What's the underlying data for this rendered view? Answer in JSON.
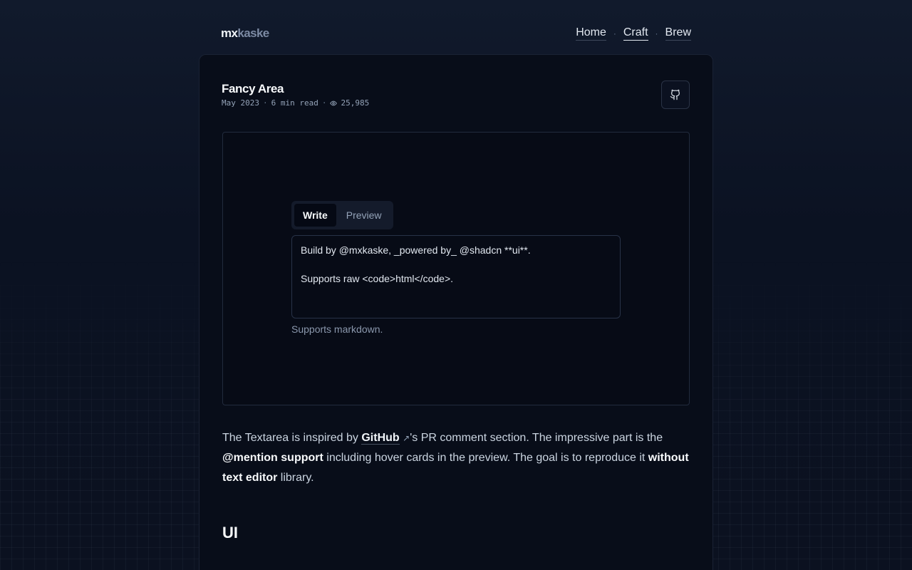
{
  "header": {
    "logo_part1": "mx",
    "logo_part2": "kaske",
    "nav": [
      {
        "label": "Home"
      },
      {
        "label": "Craft"
      },
      {
        "label": "Brew"
      }
    ],
    "nav_separator": "·"
  },
  "article": {
    "title": "Fancy Area",
    "date": "May 2023",
    "read_time": "6 min read",
    "views": "25,985",
    "meta_separator": "·",
    "github_icon": "github-icon"
  },
  "demo": {
    "tabs": [
      {
        "label": "Write",
        "active": true
      },
      {
        "label": "Preview",
        "active": false
      }
    ],
    "textarea_line1": "Build by @mxkaske, _powered by_ @shadcn **ui**.",
    "textarea_line2": "Supports raw <code>html</code>.",
    "hint": "Supports markdown."
  },
  "prose": {
    "p1_a": "The Textarea is inspired by ",
    "p1_link": "GitHub",
    "p1_b": "'s PR comment section. The impressive part is the ",
    "p1_bold1": "@mention support",
    "p1_c": " including hover cards in the preview. The goal is to reproduce it ",
    "p1_bold2": "without text editor",
    "p1_d": " library.",
    "h2": "UI"
  },
  "colors": {
    "background": "#0b1120",
    "card": "#080d19",
    "text": "#e2e8f0",
    "muted": "#94a3b8"
  }
}
